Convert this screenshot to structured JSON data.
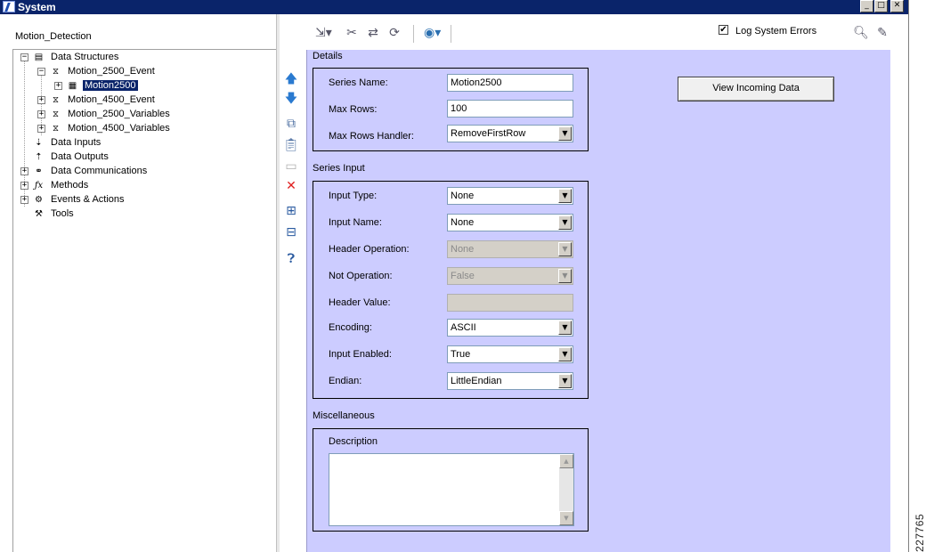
{
  "window": {
    "title": "System",
    "minimize": "_",
    "maximize": "□",
    "close": "✕"
  },
  "left": {
    "project_label": "Motion_Detection",
    "tree": [
      {
        "label": "Data Structures",
        "expander": "−",
        "icon": "▤"
      },
      {
        "label": "Motion_2500_Event",
        "expander": "−",
        "icon": "⧖"
      },
      {
        "label": "Motion2500",
        "expander": "+",
        "icon": "▦"
      },
      {
        "label": "Motion_4500_Event",
        "expander": "+",
        "icon": "⧖"
      },
      {
        "label": "Motion_2500_Variables",
        "expander": "+",
        "icon": "⧖"
      },
      {
        "label": "Motion_4500_Variables",
        "expander": "+",
        "icon": "⧖"
      },
      {
        "label": "Data Inputs",
        "expander": "",
        "icon": "⇣"
      },
      {
        "label": "Data Outputs",
        "expander": "",
        "icon": "⇡"
      },
      {
        "label": "Data Communications",
        "expander": "+",
        "icon": "⚭"
      },
      {
        "label": "Methods",
        "expander": "+",
        "icon": "ƒx"
      },
      {
        "label": "Events & Actions",
        "expander": "+",
        "icon": "⚙"
      },
      {
        "label": "Tools",
        "expander": "",
        "icon": "⚒"
      }
    ]
  },
  "toolbar": {
    "log_errors_checked": "✔",
    "log_errors_label": "Log System Errors"
  },
  "details": {
    "section_title": "Details",
    "series_name_label": "Series Name:",
    "series_name_value": "Motion2500",
    "max_rows_label": "Max Rows:",
    "max_rows_value": "100",
    "max_rows_handler_label": "Max Rows Handler:",
    "max_rows_handler_value": "RemoveFirstRow",
    "view_incoming_button": "View Incoming Data"
  },
  "series_input": {
    "section_title": "Series Input",
    "input_type_label": "Input Type:",
    "input_type_value": "None",
    "input_name_label": "Input Name:",
    "input_name_value": "None",
    "header_operation_label": "Header Operation:",
    "header_operation_value": "None",
    "not_operation_label": "Not Operation:",
    "not_operation_value": "False",
    "header_value_label": "Header Value:",
    "header_value_value": "",
    "encoding_label": "Encoding:",
    "encoding_value": "ASCII",
    "input_enabled_label": "Input Enabled:",
    "input_enabled_value": "True",
    "endian_label": "Endian:",
    "endian_value": "LittleEndian"
  },
  "misc": {
    "section_title": "Miscellaneous",
    "description_label": "Description",
    "description_value": ""
  },
  "figure_id": "227765",
  "colors": {
    "titlebar": "#0a246a",
    "content_bg": "#ccccff"
  }
}
